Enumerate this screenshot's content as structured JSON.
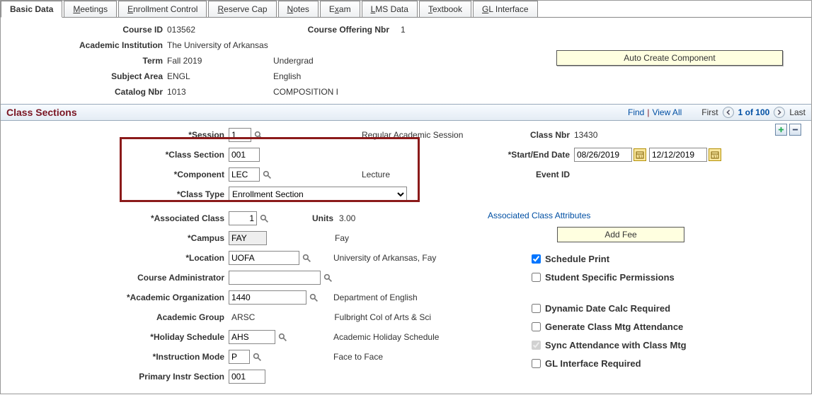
{
  "tabs": {
    "t0": "Basic Data",
    "t1": "Meetings",
    "t2": "Enrollment Control",
    "t3": "Reserve Cap",
    "t4": "Notes",
    "t5": "Exam",
    "t6": "LMS Data",
    "t7": "Textbook",
    "t8": "GL Interface"
  },
  "header": {
    "course_id_label": "Course ID",
    "course_id": "013562",
    "course_offering_nbr_label": "Course Offering Nbr",
    "course_offering_nbr": "1",
    "institution_label": "Academic Institution",
    "institution": "The University of Arkansas",
    "term_label": "Term",
    "term": "Fall 2019",
    "term_desc": "Undergrad",
    "subject_label": "Subject Area",
    "subject": "ENGL",
    "subject_desc": "English",
    "catalog_label": "Catalog Nbr",
    "catalog": "1013",
    "catalog_desc": "COMPOSITION I",
    "auto_create": "Auto Create Component"
  },
  "section_bar": {
    "title": "Class Sections",
    "find": "Find",
    "view_all": "View All",
    "first": "First",
    "position": "1 of 100",
    "last": "Last"
  },
  "form": {
    "session_label": "*Session",
    "session": "1",
    "session_desc": "Regular Academic Session",
    "class_section_label": "*Class Section",
    "class_section": "001",
    "component_label": "*Component",
    "component": "LEC",
    "component_desc": "Lecture",
    "class_type_label": "*Class Type",
    "class_type": "Enrollment Section",
    "assoc_class_label": "*Associated Class",
    "assoc_class": "1",
    "units_label": "Units",
    "units": "3.00",
    "campus_label": "*Campus",
    "campus": "FAY",
    "campus_desc": "Fay",
    "location_label": "*Location",
    "location": "UOFA",
    "location_desc": "University of Arkansas, Fay",
    "course_admin_label": "Course Administrator",
    "course_admin": "",
    "acad_org_label": "*Academic Organization",
    "acad_org": "1440",
    "acad_org_desc": "Department of English",
    "acad_group_label": "Academic Group",
    "acad_group": "ARSC",
    "acad_group_desc": "Fulbright Col of Arts & Sci",
    "holiday_label": "*Holiday Schedule",
    "holiday": "AHS",
    "holiday_desc": "Academic Holiday Schedule",
    "instr_mode_label": "*Instruction Mode",
    "instr_mode": "P",
    "instr_mode_desc": "Face to Face",
    "primary_instr_label": "Primary Instr Section",
    "primary_instr": "001"
  },
  "right": {
    "class_nbr_label": "Class Nbr",
    "class_nbr": "13430",
    "dates_label": "*Start/End Date",
    "start_date": "08/26/2019",
    "end_date": "12/12/2019",
    "event_id_label": "Event ID",
    "assoc_attr_link": "Associated Class Attributes",
    "add_fee": "Add Fee",
    "schedule_print": "Schedule Print",
    "student_perms": "Student Specific Permissions",
    "dynamic_date": "Dynamic Date Calc Required",
    "gen_attendance": "Generate Class Mtg Attendance",
    "sync_attendance": "Sync Attendance with Class Mtg",
    "gl_required": "GL Interface Required"
  }
}
